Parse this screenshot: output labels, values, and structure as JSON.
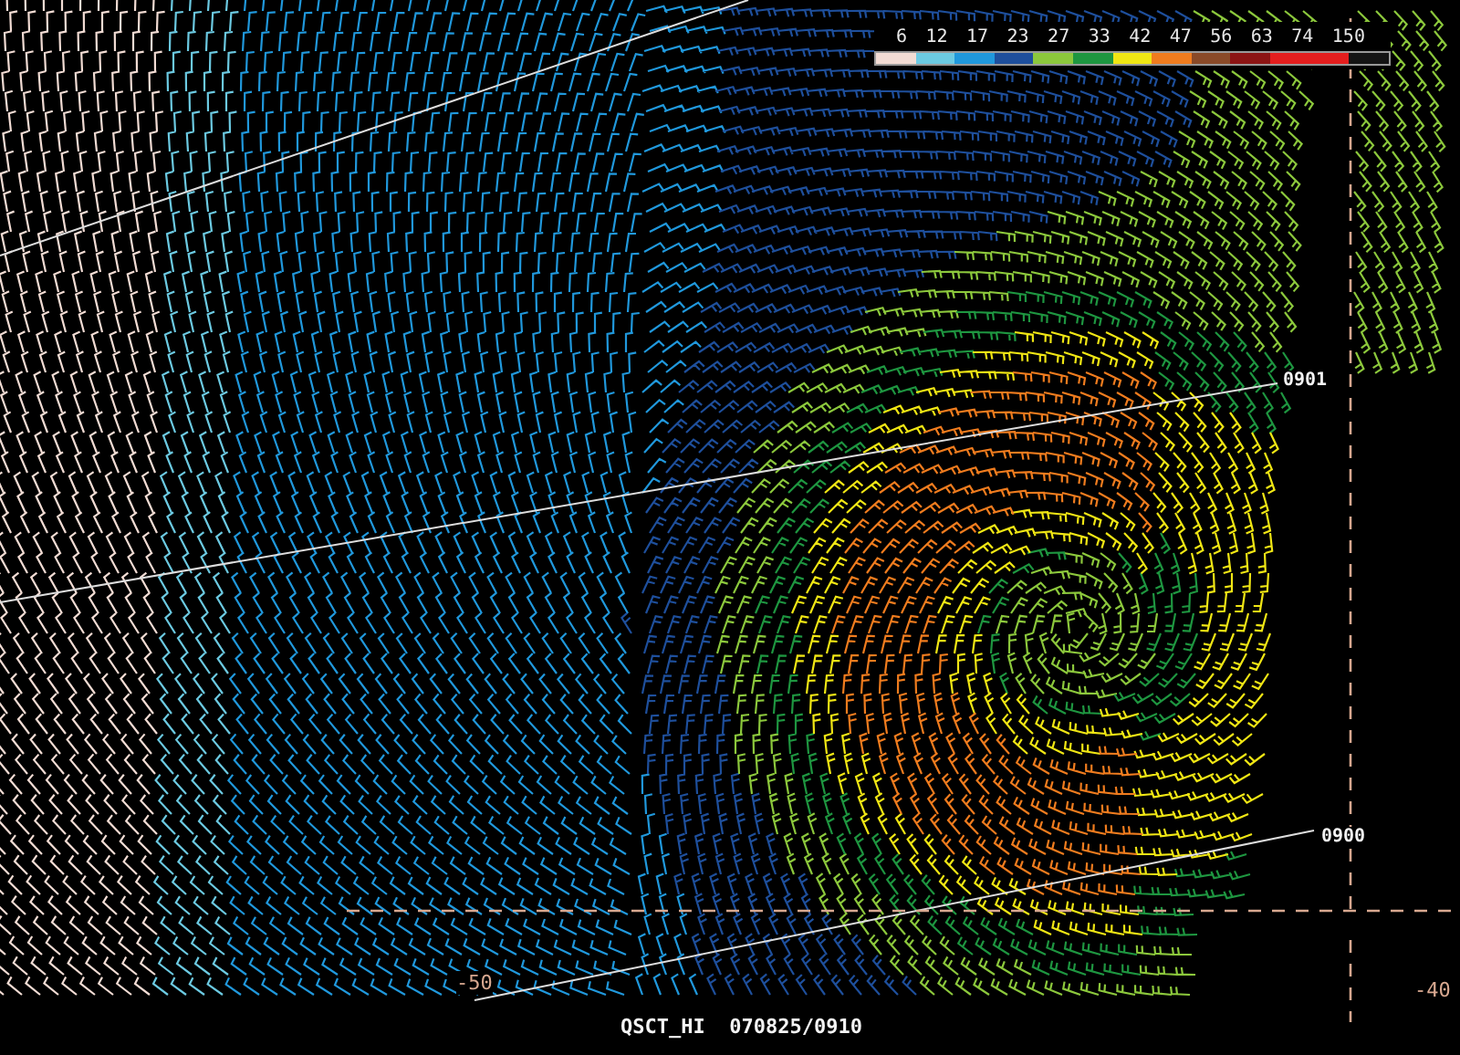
{
  "legend": {
    "labels": [
      "6",
      "12",
      "17",
      "23",
      "27",
      "33",
      "42",
      "47",
      "56",
      "63",
      "74",
      "150"
    ],
    "swatches": [
      {
        "color": "#f2dcd4"
      },
      {
        "color": "#6ccae2"
      },
      {
        "color": "#2098dc"
      },
      {
        "color": "#1e4f9c"
      },
      {
        "color": "#8cc83c"
      },
      {
        "color": "#1e9640"
      },
      {
        "color": "#f0e614"
      },
      {
        "color": "#f07c1e"
      },
      {
        "color": "#8a4a28"
      },
      {
        "color": "#8c1414"
      },
      {
        "color": "#e41e1e"
      },
      {
        "color": "#e41e1e"
      },
      {
        "color": "#141414"
      }
    ]
  },
  "map": {
    "track_labels": [
      "0901",
      "0900"
    ],
    "grid_labels": [
      "-50",
      "-40"
    ]
  },
  "caption": "QSCT_HI  070825/0910"
}
